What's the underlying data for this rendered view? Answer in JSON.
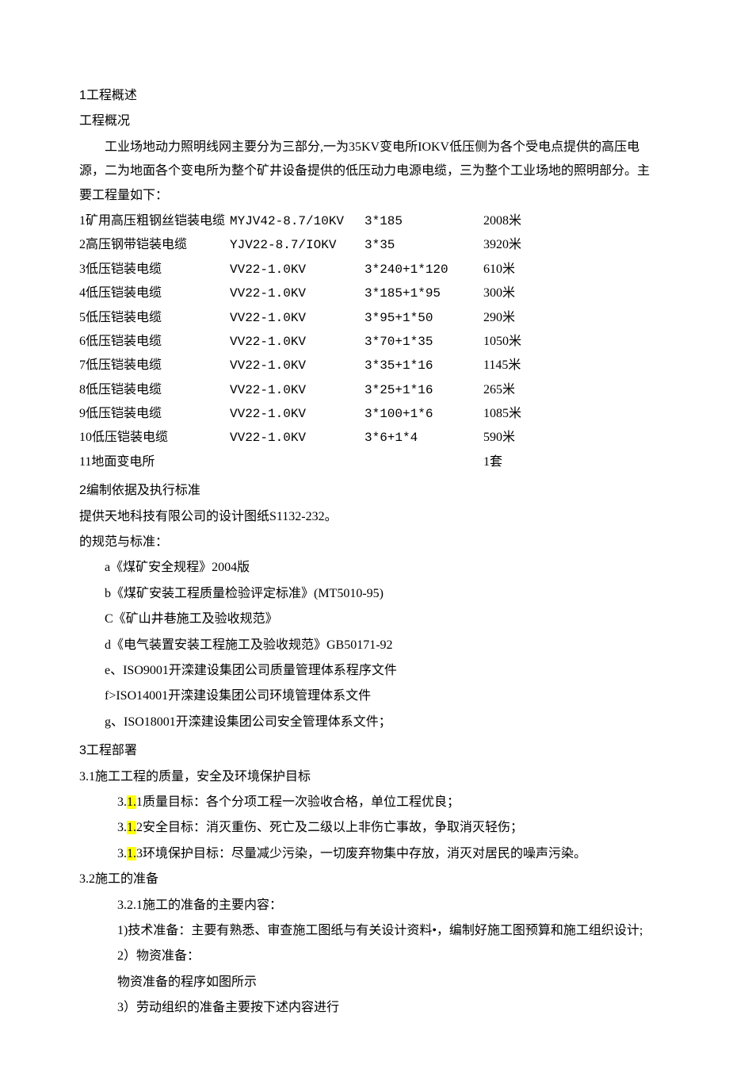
{
  "sec1": {
    "heading_num": "1",
    "heading_txt": "工程概述",
    "sub": "工程概况",
    "intro": "工业场地动力照明线网主要分为三部分,一为35KV变电所IOKV低压侧为各个受电点提供的高压电源，二为地面各个变电所为整个矿井设备提供的低压动力电源电缆，三为整个工业场地的照明部分。主要工程量如下：",
    "rows": [
      {
        "n": "1",
        "name": "矿用高压粗钢丝铠装电缆",
        "model": "MYJV42-8.7/10KV",
        "spec": "3*185",
        "qty": "2008米"
      },
      {
        "n": "2",
        "name": "高压钢带铠装电缆",
        "model": "YJV22-8.7/IOKV",
        "spec": "3*35",
        "qty": "3920米"
      },
      {
        "n": "3",
        "name": "低压铠装电缆",
        "model": "VV22-1.0KV",
        "spec": "3*240+1*120",
        "qty": "610米"
      },
      {
        "n": "4",
        "name": "低压铠装电缆",
        "model": "VV22-1.0KV",
        "spec": "3*185+1*95",
        "qty": "300米"
      },
      {
        "n": "5",
        "name": "低压铠装电缆",
        "model": "VV22-1.0KV",
        "spec": "3*95+1*50",
        "qty": "290米"
      },
      {
        "n": "6",
        "name": "低压铠装电缆",
        "model": "VV22-1.0KV",
        "spec": "3*70+1*35",
        "qty": "1050米"
      },
      {
        "n": "7",
        "name": "低压铠装电缆",
        "model": "VV22-1.0KV",
        "spec": "3*35+1*16",
        "qty": "1145米"
      },
      {
        "n": "8",
        "name": "低压铠装电缆",
        "model": "VV22-1.0KV",
        "spec": "3*25+1*16",
        "qty": "265米"
      },
      {
        "n": "9",
        "name": "低压铠装电缆",
        "model": "VV22-1.0KV",
        "spec": "3*100+1*6",
        "qty": "1085米"
      },
      {
        "n": "10",
        "name": "低压铠装电缆",
        "model": "VV22-1.0KV",
        "spec": "3*6+1*4",
        "qty": "590米"
      },
      {
        "n": "11",
        "name": "地面变电所",
        "model": "",
        "spec": "",
        "qty": "1套"
      }
    ]
  },
  "sec2": {
    "heading_num": "2",
    "heading_txt": "编制依据及执行标准",
    "line1": "提供天地科技有限公司的设计图纸S1132-232。",
    "line2": "的规范与标准：",
    "items": [
      "a《煤矿安全规程》2004版",
      "b《煤矿安装工程质量检验评定标准》(MT5010-95)",
      "C《矿山井巷施工及验收规范》",
      "d《电气装置安装工程施工及验收规范》GB50171-92",
      "e、ISO9001开滦建设集团公司质量管理体系程序文件",
      "f>ISO14001开滦建设集团公司环境管理体系文件",
      "g、ISO18001开滦建设集团公司安全管理体系文件；"
    ]
  },
  "sec3": {
    "heading_num": "3",
    "heading_txt": "工程部署",
    "s31": "3.1施工工程的质量，安全及环境保护目标",
    "s311_pre": "3.",
    "s311_hl": "1.",
    "s311_post": "1质量目标：各个分项工程一次验收合格，单位工程优良；",
    "s312_pre": "3.",
    "s312_hl": "1.",
    "s312_post": "2安全目标：消灭重伤、死亡及二级以上非伤亡事故，争取消灭轻伤；",
    "s313_pre": "3.",
    "s313_hl": "1.",
    "s313_post": "3环境保护目标：尽量减少污染，一切废弃物集中存放，消灭对居民的噪声污染。",
    "s32": "3.2施工的准备",
    "s321": "3.2.1施工的准备的主要内容：",
    "s321_1": "1)技术准备：主要有熟悉、审查施工图纸与有关设计资料•，编制好施工图预算和施工组织设计;",
    "s321_2": "2）物资准备：",
    "s321_2b": "物资准备的程序如图所示",
    "s321_3": "3）劳动组织的准备主要按下述内容进行"
  }
}
